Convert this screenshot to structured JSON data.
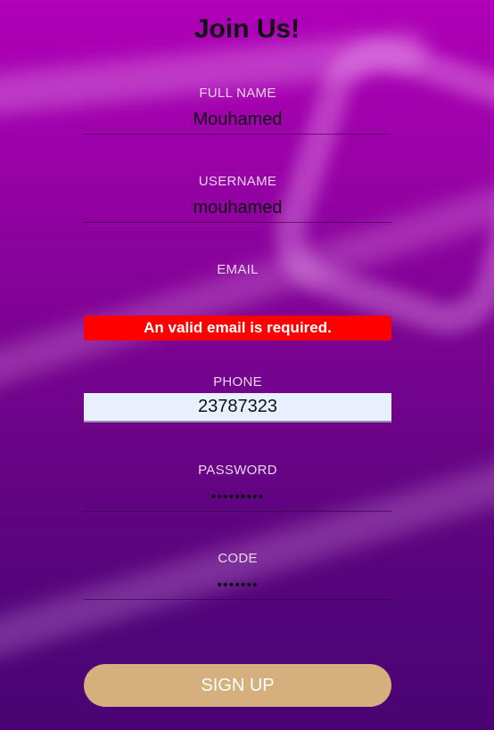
{
  "title": "Join Us!",
  "fields": {
    "full_name": {
      "label": "FULL NAME",
      "value": "Mouhamed"
    },
    "username": {
      "label": "USERNAME",
      "value": "mouhamed"
    },
    "email": {
      "label": "EMAIL",
      "value": "",
      "error": "An valid email is required."
    },
    "phone": {
      "label": "PHONE",
      "value": "23787323"
    },
    "password": {
      "label": "PASSWORD",
      "value": "•••••••••"
    },
    "code": {
      "label": "CODE",
      "value": "•••••••"
    }
  },
  "signup_button": "SIGN UP",
  "colors": {
    "error_bg": "#ff0000",
    "button_bg": "#d4b07c",
    "autofill_bg": "#e8f0fe"
  }
}
